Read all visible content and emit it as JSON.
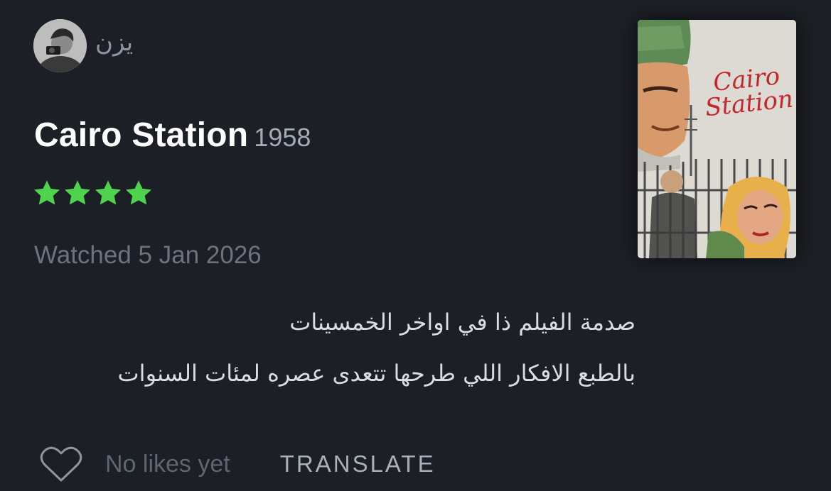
{
  "user": {
    "name": "يزن"
  },
  "film": {
    "title": "Cairo Station",
    "year": "1958",
    "rating_stars": 4,
    "poster": {
      "title_line1": "Cairo",
      "title_line2": "Station"
    }
  },
  "watched": "Watched 5 Jan 2026",
  "review": {
    "lines": [
      "صدمة الفيلم ذا في اواخر الخمسينات",
      "بالطبع الافكار اللي طرحها تتعدى عصره لمئات السنوات"
    ]
  },
  "footer": {
    "likes": "No likes yet",
    "translate": "TRANSLATE"
  },
  "colors": {
    "background": "#1c1f25",
    "star": "#4fd34f",
    "poster_title": "#c5262c"
  },
  "icons": {
    "like": "heart-outline-icon",
    "rating": "star-icon"
  }
}
